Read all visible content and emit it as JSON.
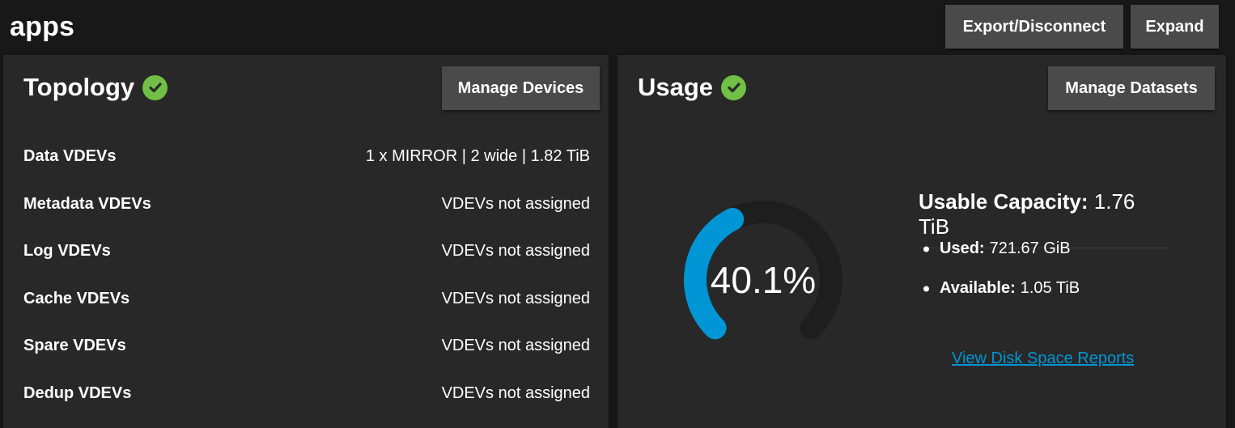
{
  "header": {
    "pool_name": "apps",
    "export_label": "Export/Disconnect",
    "expand_label": "Expand"
  },
  "topology": {
    "title": "Topology",
    "manage_label": "Manage Devices",
    "rows": [
      {
        "label": "Data VDEVs",
        "value": "1 x MIRROR | 2 wide | 1.82 TiB"
      },
      {
        "label": "Metadata VDEVs",
        "value": "VDEVs not assigned"
      },
      {
        "label": "Log VDEVs",
        "value": "VDEVs not assigned"
      },
      {
        "label": "Cache VDEVs",
        "value": "VDEVs not assigned"
      },
      {
        "label": "Spare VDEVs",
        "value": "VDEVs not assigned"
      },
      {
        "label": "Dedup VDEVs",
        "value": "VDEVs not assigned"
      }
    ]
  },
  "usage": {
    "title": "Usage",
    "manage_label": "Manage Datasets",
    "percent_text": "40.1%",
    "percent_value": 40.1,
    "usable_capacity_label": "Usable Capacity:",
    "usable_capacity_value": "1.76 TiB",
    "used_label": "Used:",
    "used_value": "721.67 GiB",
    "available_label": "Available:",
    "available_value": "1.05 TiB",
    "report_link": "View Disk Space Reports"
  },
  "colors": {
    "accent": "#0095d5",
    "status_ok": "#71bf44",
    "gauge_track": "#1e1e1e"
  },
  "icons": {
    "topology_status": "check-circle-icon",
    "usage_status": "check-circle-icon"
  }
}
